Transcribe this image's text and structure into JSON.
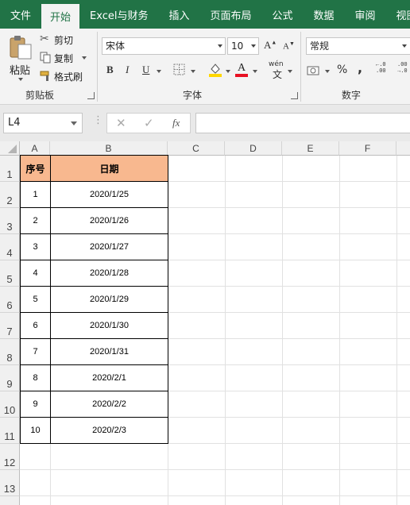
{
  "tabs": [
    "文件",
    "开始",
    "Excel与财务",
    "插入",
    "页面布局",
    "公式",
    "数据",
    "审阅",
    "视图"
  ],
  "active_tab_index": 1,
  "clipboard": {
    "paste_label": "粘贴",
    "cut_label": "剪切",
    "copy_label": "复制",
    "format_painter_label": "格式刷",
    "group_label": "剪贴板"
  },
  "font": {
    "font_name": "宋体",
    "font_size": "10",
    "bold": "B",
    "italic": "I",
    "underline": "U",
    "phonetic": "wén",
    "group_label": "字体"
  },
  "number": {
    "format": "常规",
    "percent": "%",
    "comma": ",",
    "group_label": "数字"
  },
  "formula_bar": {
    "name_box": "L4",
    "fx": "fx",
    "formula": ""
  },
  "columns": [
    "A",
    "B",
    "C",
    "D",
    "E",
    "F"
  ],
  "rows": [
    "1",
    "2",
    "3",
    "4",
    "5",
    "6",
    "7",
    "8",
    "9",
    "10",
    "11",
    "12",
    "13"
  ],
  "table": {
    "headers": [
      "序号",
      "日期"
    ],
    "rows": [
      [
        "1",
        "2020/1/25"
      ],
      [
        "2",
        "2020/1/26"
      ],
      [
        "3",
        "2020/1/27"
      ],
      [
        "4",
        "2020/1/28"
      ],
      [
        "5",
        "2020/1/29"
      ],
      [
        "6",
        "2020/1/30"
      ],
      [
        "7",
        "2020/1/31"
      ],
      [
        "8",
        "2020/2/1"
      ],
      [
        "9",
        "2020/2/2"
      ],
      [
        "10",
        "2020/2/3"
      ]
    ]
  },
  "colors": {
    "ribbon_green": "#217346",
    "header_fill": "#f8b88f",
    "font_color_bar": "#e81123",
    "fill_color_bar": "#ffd700"
  }
}
